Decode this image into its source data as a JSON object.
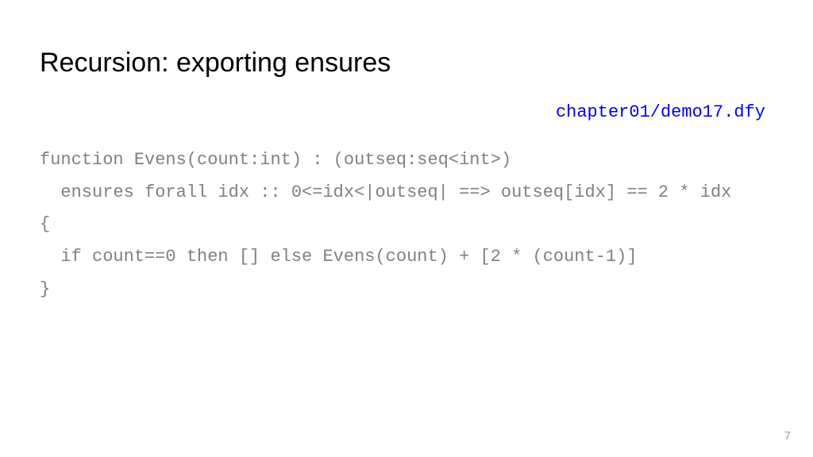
{
  "slide": {
    "title": "Recursion: exporting ensures",
    "file_path": "chapter01/demo17.dfy",
    "code_lines": {
      "l1": "function Evens(count:int) : (outseq:seq<int>)",
      "l2": "  ensures forall idx :: 0<=idx<|outseq| ==> outseq[idx] == 2 * idx",
      "l3": "{",
      "l4": "  if count==0 then [] else Evens(count) + [2 * (count-1)]",
      "l5": "}"
    },
    "page_number": "7"
  }
}
